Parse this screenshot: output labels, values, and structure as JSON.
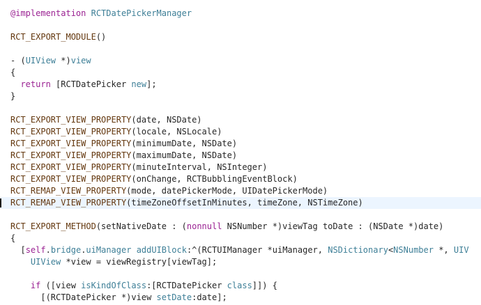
{
  "editor": {
    "highlighted_line": 16,
    "lines": [
      [
        {
          "t": "@implementation",
          "c": "kw"
        },
        {
          "t": " ",
          "c": "p"
        },
        {
          "t": "RCTDatePickerManager",
          "c": "cls"
        }
      ],
      [],
      [
        {
          "t": "RCT_EXPORT_MODULE",
          "c": "macro"
        },
        {
          "t": "()",
          "c": "p"
        }
      ],
      [],
      [
        {
          "t": "- (",
          "c": "p"
        },
        {
          "t": "UIView",
          "c": "cls"
        },
        {
          "t": " *)",
          "c": "p"
        },
        {
          "t": "view",
          "c": "sel"
        }
      ],
      [
        {
          "t": "{",
          "c": "p"
        }
      ],
      [
        {
          "t": "  ",
          "c": "p"
        },
        {
          "t": "return",
          "c": "kw"
        },
        {
          "t": " [RCTDatePicker ",
          "c": "p"
        },
        {
          "t": "new",
          "c": "sel"
        },
        {
          "t": "];",
          "c": "p"
        }
      ],
      [
        {
          "t": "}",
          "c": "p"
        }
      ],
      [],
      [
        {
          "t": "RCT_EXPORT_VIEW_PROPERTY",
          "c": "macro"
        },
        {
          "t": "(date, NSDate)",
          "c": "p"
        }
      ],
      [
        {
          "t": "RCT_EXPORT_VIEW_PROPERTY",
          "c": "macro"
        },
        {
          "t": "(locale, NSLocale)",
          "c": "p"
        }
      ],
      [
        {
          "t": "RCT_EXPORT_VIEW_PROPERTY",
          "c": "macro"
        },
        {
          "t": "(minimumDate, NSDate)",
          "c": "p"
        }
      ],
      [
        {
          "t": "RCT_EXPORT_VIEW_PROPERTY",
          "c": "macro"
        },
        {
          "t": "(maximumDate, NSDate)",
          "c": "p"
        }
      ],
      [
        {
          "t": "RCT_EXPORT_VIEW_PROPERTY",
          "c": "macro"
        },
        {
          "t": "(minuteInterval, NSInteger)",
          "c": "p"
        }
      ],
      [
        {
          "t": "RCT_EXPORT_VIEW_PROPERTY",
          "c": "macro"
        },
        {
          "t": "(onChange, RCTBubblingEventBlock)",
          "c": "p"
        }
      ],
      [
        {
          "t": "RCT_REMAP_VIEW_PROPERTY",
          "c": "macro"
        },
        {
          "t": "(mode, datePickerMode, UIDatePickerMode)",
          "c": "p"
        }
      ],
      [
        {
          "t": "RCT_REMAP_VIEW_PROPERTY",
          "c": "macro"
        },
        {
          "t": "(timeZoneOffsetInMinutes, timeZone, NSTimeZone)",
          "c": "p"
        }
      ],
      [],
      [
        {
          "t": "RCT_EXPORT_METHOD",
          "c": "macro"
        },
        {
          "t": "(setNativeDate : (",
          "c": "p"
        },
        {
          "t": "nonnull",
          "c": "kw"
        },
        {
          "t": " NSNumber *)viewTag toDate : (NSDate *)date)",
          "c": "p"
        }
      ],
      [
        {
          "t": "{",
          "c": "p"
        }
      ],
      [
        {
          "t": "  [",
          "c": "p"
        },
        {
          "t": "self",
          "c": "kw"
        },
        {
          "t": ".",
          "c": "p"
        },
        {
          "t": "bridge",
          "c": "sel"
        },
        {
          "t": ".",
          "c": "p"
        },
        {
          "t": "uiManager",
          "c": "sel"
        },
        {
          "t": " ",
          "c": "p"
        },
        {
          "t": "addUIBlock",
          "c": "sel"
        },
        {
          "t": ":^(RCTUIManager *uiManager, ",
          "c": "p"
        },
        {
          "t": "NSDictionary",
          "c": "cls"
        },
        {
          "t": "<",
          "c": "p"
        },
        {
          "t": "NSNumber",
          "c": "cls"
        },
        {
          "t": " *, ",
          "c": "p"
        },
        {
          "t": "UIV",
          "c": "cls"
        }
      ],
      [
        {
          "t": "    ",
          "c": "p"
        },
        {
          "t": "UIView",
          "c": "cls"
        },
        {
          "t": " *view = viewRegistry[viewTag];",
          "c": "p"
        }
      ],
      [],
      [
        {
          "t": "    ",
          "c": "p"
        },
        {
          "t": "if",
          "c": "kw"
        },
        {
          "t": " ([view ",
          "c": "p"
        },
        {
          "t": "isKindOfClass",
          "c": "sel"
        },
        {
          "t": ":[RCTDatePicker ",
          "c": "p"
        },
        {
          "t": "class",
          "c": "sel"
        },
        {
          "t": "]]) {",
          "c": "p"
        }
      ],
      [
        {
          "t": "      [(RCTDatePicker *)view ",
          "c": "p"
        },
        {
          "t": "setDate",
          "c": "sel"
        },
        {
          "t": ":date];",
          "c": "p"
        }
      ]
    ]
  }
}
